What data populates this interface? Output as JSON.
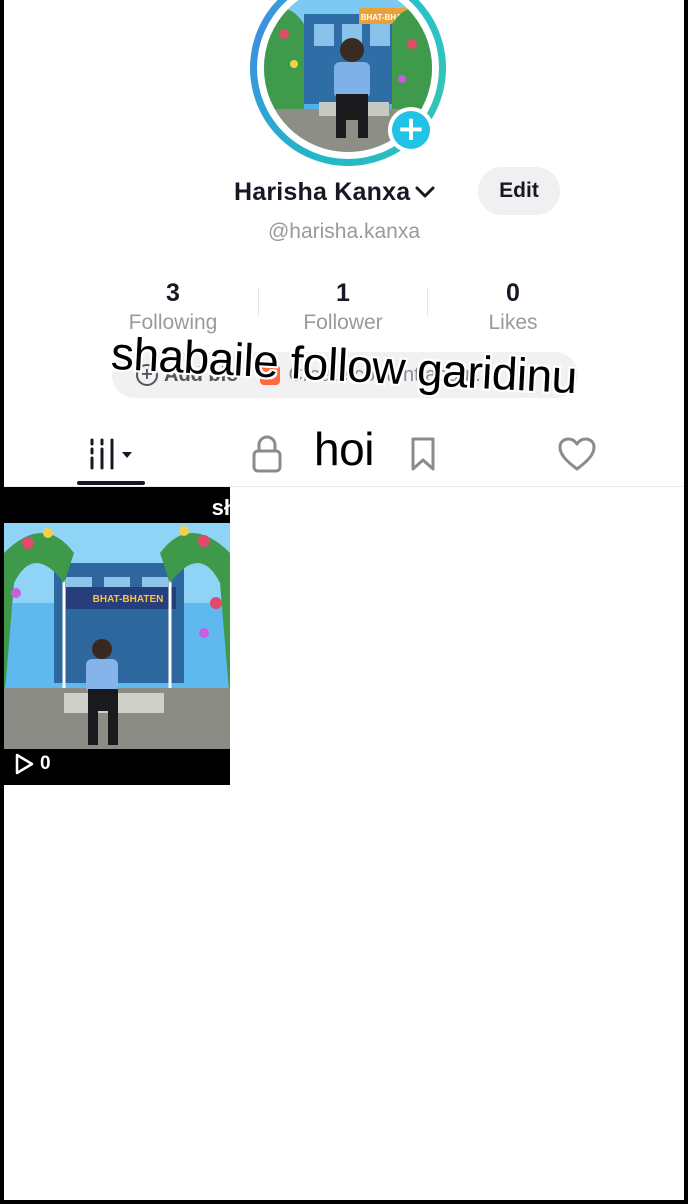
{
  "profile": {
    "display_name": "Harisha Kanxa",
    "username": "@harisha.kanxa",
    "edit_label": "Edit",
    "avatar_sign_text": "BHAT-BHATEN"
  },
  "stats": [
    {
      "value": "3",
      "label": "Following"
    },
    {
      "value": "1",
      "label": "Follower"
    },
    {
      "value": "0",
      "label": "Likes"
    }
  ],
  "bio_prompt": {
    "add_bio_label": "Add bio",
    "suggestion_text": "Create content about..."
  },
  "tabs": [
    {
      "icon": "grid-icon",
      "active": true
    },
    {
      "icon": "lock-icon",
      "active": false
    },
    {
      "icon": "bookmark-icon",
      "active": false
    },
    {
      "icon": "heart-icon",
      "active": false
    }
  ],
  "caption": {
    "line1": "shabaile follow garidinu",
    "line2": "hoi"
  },
  "videos": [
    {
      "top_text": "sł",
      "sign_text": "BHAT-BHATEN",
      "views": "0"
    }
  ],
  "colors": {
    "accent": "#20c2e6",
    "ring": "#20b7c9",
    "text_primary": "#161823",
    "text_secondary": "#9a9a9e"
  }
}
